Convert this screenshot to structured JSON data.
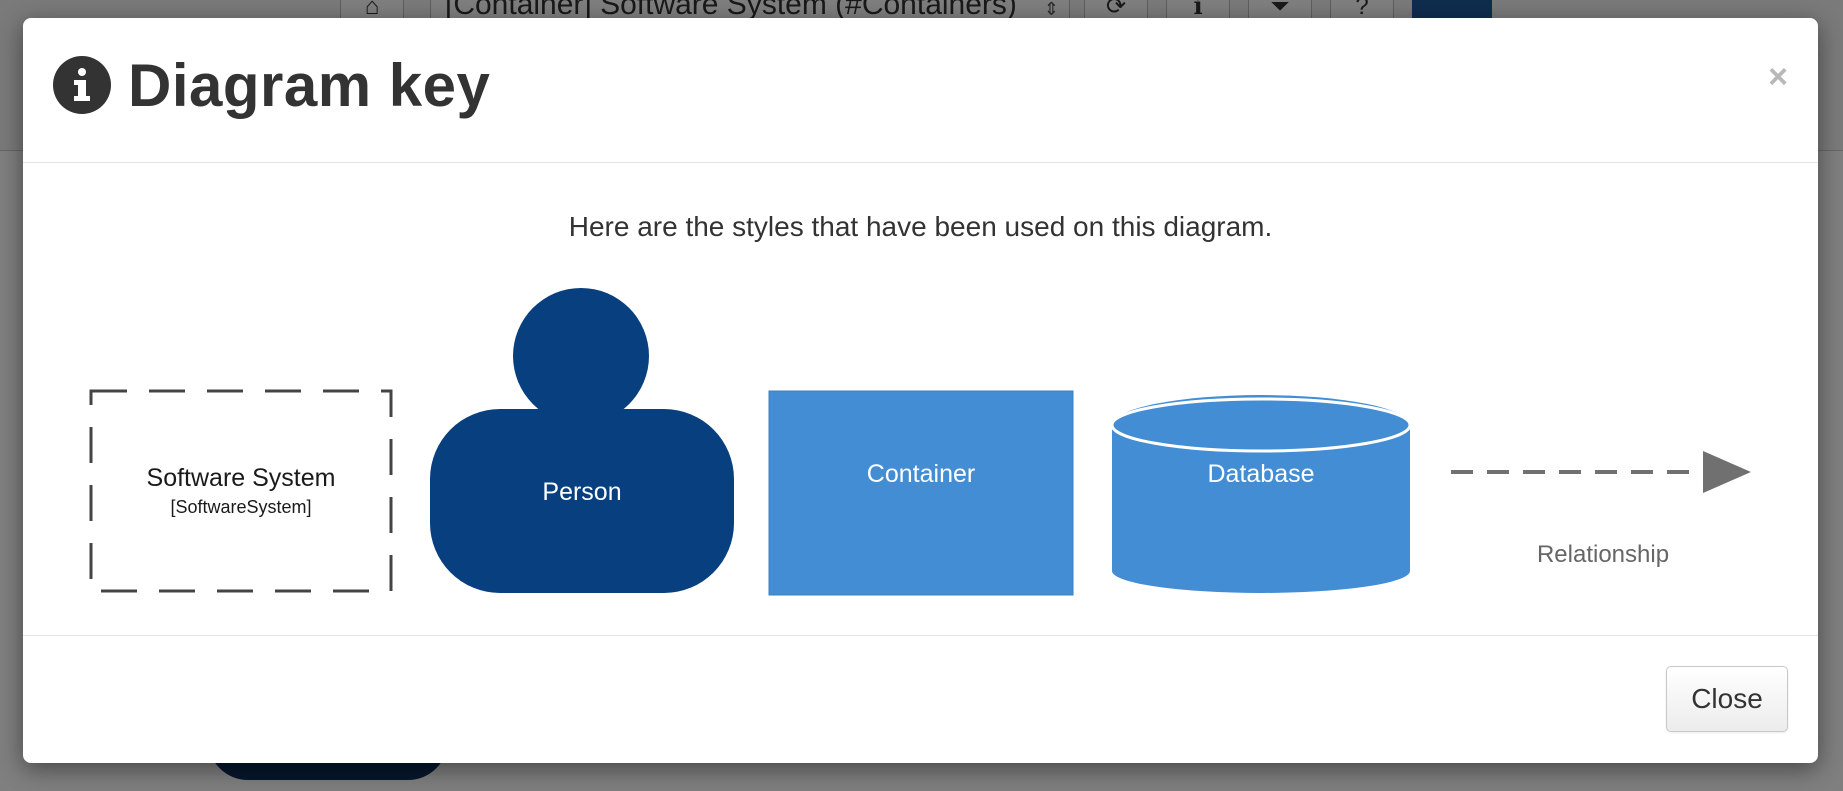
{
  "background": {
    "view_selector": "[Container] Software System (#Containers)",
    "toolbar_icons": [
      "home-icon",
      "refresh-icon",
      "info-icon",
      "filter-icon",
      "help-icon"
    ]
  },
  "modal": {
    "title": "Diagram key",
    "close_symbol": "×",
    "intro": "Here are the styles that have been used on this diagram.",
    "elements": {
      "software_system": {
        "name": "Software System",
        "type": "[SoftwareSystem]"
      },
      "person": {
        "name": "Person"
      },
      "container": {
        "name": "Container"
      },
      "database": {
        "name": "Database"
      },
      "relationship": {
        "name": "Relationship"
      }
    },
    "close_button": "Close"
  },
  "colors": {
    "person": "#083f7e",
    "container": "#438dd5",
    "database": "#438dd5",
    "dashed_border": "#444444",
    "relationship": "#707070"
  }
}
